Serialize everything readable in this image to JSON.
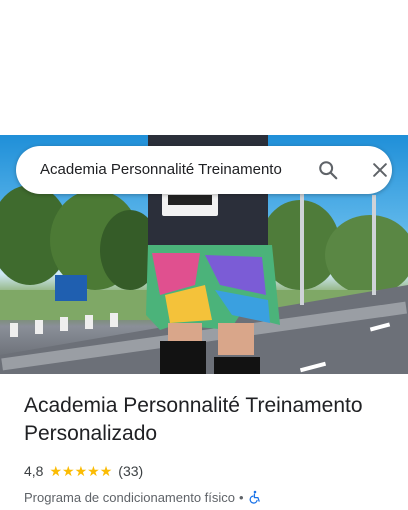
{
  "search": {
    "query": "Academia Personnalité Treinamento"
  },
  "icons": {
    "search": "search-icon",
    "close": "close-icon",
    "wheelchair": "wheelchair-accessible-icon",
    "star": "star-icon"
  },
  "place": {
    "title": "Academia Personnalité Treinamento Personalizado",
    "rating": "4,8",
    "stars": 5,
    "reviews": "(33)",
    "category": "Programa de condicionamento físico",
    "separator": "•"
  },
  "colors": {
    "star": "#fbbc04",
    "accessible": "#1a73e8",
    "icon": "#5f6368"
  }
}
